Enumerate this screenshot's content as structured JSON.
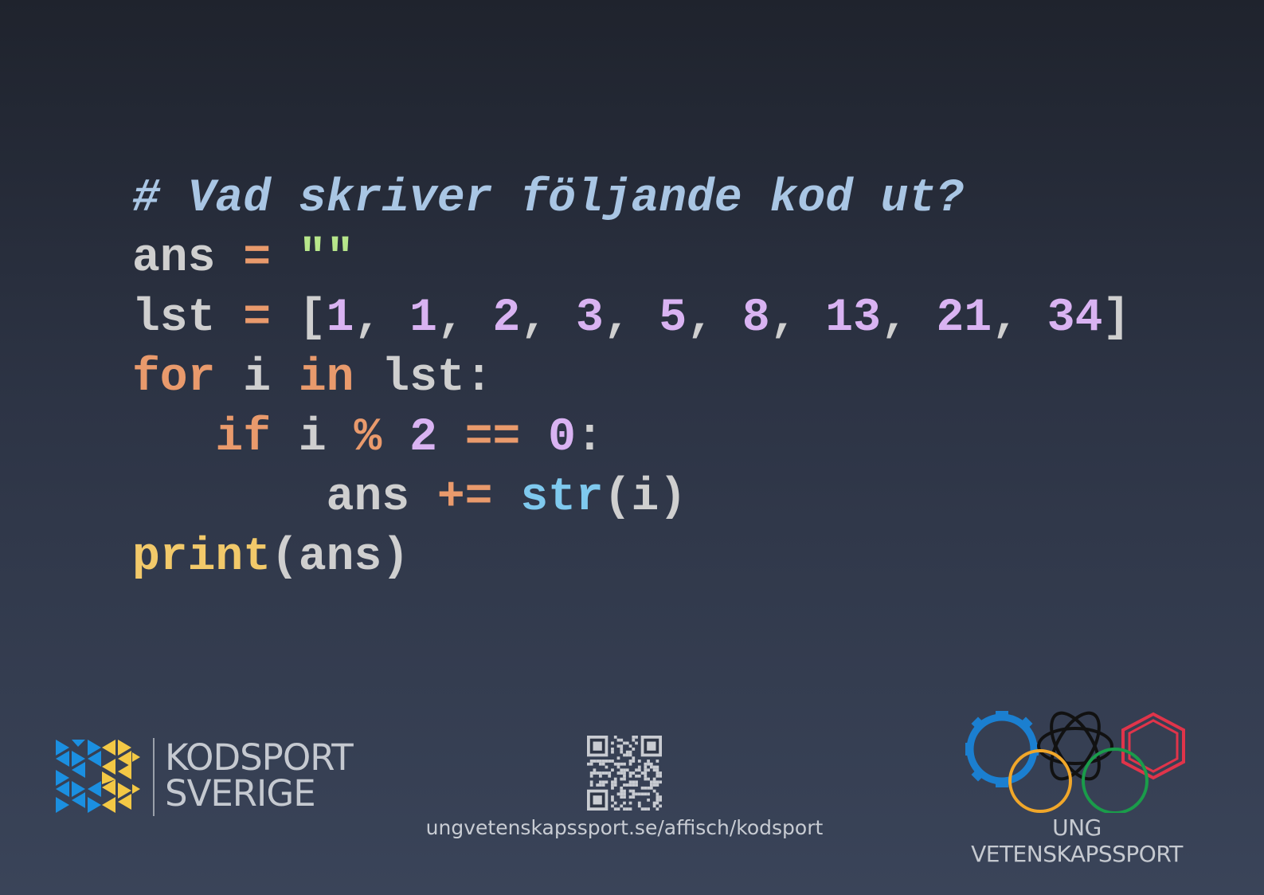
{
  "code": {
    "comment": "# Vad skriver följande kod ut?",
    "line2": {
      "var": "ans",
      "op": "=",
      "str": "\"\""
    },
    "line3": {
      "var": "lst",
      "op": "=",
      "open": "[",
      "items": [
        "1",
        "1",
        "2",
        "3",
        "5",
        "8",
        "13",
        "21",
        "34"
      ],
      "close": "]"
    },
    "line4": {
      "kw_for": "for",
      "var": "i",
      "kw_in": "in",
      "iter": "lst:"
    },
    "line5": {
      "kw_if": "if",
      "var": "i",
      "op_mod": "%",
      "num": "2",
      "op_eq": "==",
      "zero": "0",
      "colon": ":"
    },
    "line6": {
      "var": "ans",
      "op": "+=",
      "builtin": "str",
      "args": "(i)"
    },
    "line7": {
      "fn": "print",
      "args": "(ans)"
    }
  },
  "footer": {
    "left_brand": {
      "line1": "KODSPORT",
      "line2": "SVERIGE"
    },
    "url": "ungvetenskapssport.se/affisch/kodsport",
    "right_brand": "UNG VETENSKAPSSPORT"
  },
  "colors": {
    "comment": "#a9c6e4",
    "keyword": "#e99a6c",
    "string": "#b7e68b",
    "number": "#d9b3f2",
    "builtin": "#7fc9ee",
    "function": "#f2c96a",
    "logo_blue": "#1b8fe0",
    "logo_yellow": "#f3c845"
  }
}
